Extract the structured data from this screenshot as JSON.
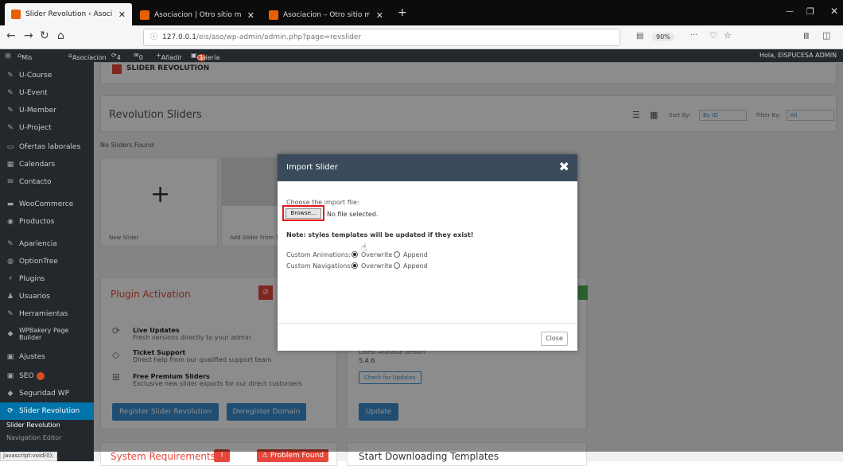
{
  "browser": {
    "tabs": [
      {
        "title": "Slider Revolution ‹ Asociacion",
        "close": "✕"
      },
      {
        "title": "Asociacion | Otro sitio más de",
        "close": "✕"
      },
      {
        "title": "Asociacion – Otro sitio más de",
        "close": "✕"
      }
    ],
    "new_tab": "+",
    "url_host": "127.0.0.1",
    "url_path": "/eis/aso/wp-admin/admin.php?page=revslider",
    "zoom": "90%",
    "more": "···"
  },
  "adminbar": {
    "my_sites": "Mis sitios",
    "site": "Asociacion",
    "updates": "4",
    "comments": "0",
    "add_new": "Añadir",
    "gallery_badge": "1",
    "gallery": "Galería",
    "greeting": "Hola, EISPUCESA ADMIN"
  },
  "sidebar": {
    "items": [
      {
        "label": "U-Course",
        "icon": "pin-icon"
      },
      {
        "label": "U-Event",
        "icon": "pin-icon"
      },
      {
        "label": "U-Member",
        "icon": "pin-icon"
      },
      {
        "label": "U-Project",
        "icon": "pin-icon"
      },
      {
        "label": "Ofertas laborales",
        "icon": "briefcase-icon"
      },
      {
        "label": "Calendars",
        "icon": "calendar-icon"
      },
      {
        "label": "Contacto",
        "icon": "mail-icon"
      },
      {
        "label": "WooCommerce",
        "icon": "woo-icon"
      },
      {
        "label": "Productos",
        "icon": "box-icon"
      },
      {
        "label": "Apariencia",
        "icon": "brush-icon"
      },
      {
        "label": "OptionTree",
        "icon": "tree-icon"
      },
      {
        "label": "Plugins",
        "icon": "plug-icon"
      },
      {
        "label": "Usuarios",
        "icon": "users-icon"
      },
      {
        "label": "Herramientas",
        "icon": "wrench-icon"
      },
      {
        "label": "WPBakery Page Builder",
        "icon": "bakery-icon"
      },
      {
        "label": "Ajustes",
        "icon": "settings-icon"
      },
      {
        "label": "SEO",
        "icon": "seo-icon"
      },
      {
        "label": "Seguridad WP",
        "icon": "shield-icon"
      },
      {
        "label": "Slider Revolution",
        "icon": "refresh-icon"
      }
    ],
    "sub": [
      "Slider Revolution",
      "Navigation Editor"
    ]
  },
  "content": {
    "logo": "SLIDER REVOLUTION",
    "header_title": "Revolution Sliders",
    "sort_label": "Sort By:",
    "sort_value": "By ID",
    "filter_label": "Filter By:",
    "filter_value": "All",
    "no_sliders": "No Sliders Found",
    "plus": "+",
    "new_slider": "New Slider",
    "add_template": "Add Slider From Template",
    "plugin_activation": "Plugin Activation",
    "features": [
      {
        "title": "Live Updates",
        "desc": "Fresh versions directly to your admin"
      },
      {
        "title": "Ticket Support",
        "desc": "Direct help from our qualified support team"
      },
      {
        "title": "Free Premium Sliders",
        "desc": "Exclusive new slider exports for our direct customers"
      }
    ],
    "register_btn": "Register Slider Revolution",
    "deregister_btn": "Deregister Domain",
    "latest_label": "Latest Available Version",
    "latest_value": "5.4.6",
    "check_updates": "Check for Updates",
    "update_btn": "Update",
    "sys_req": "System Requirements",
    "problem_found": "Problem Found",
    "start_download": "Start Downloading Templates"
  },
  "modal": {
    "title": "Import Slider",
    "close_x": "✖",
    "choose_label": "Choose the import file:",
    "browse": "Browse...",
    "no_file": "No file selected.",
    "note": "Note: styles templates will be updated if they exist!",
    "custom_animations": "Custom Animations:",
    "custom_navigations": "Custom Navigations:",
    "overwrite": "Overwrite",
    "append": "Append",
    "close_btn": "Close"
  },
  "statusbar": "javascript:void(0);",
  "colors": {
    "wp_dark": "#23282d",
    "wp_blue": "#0073aa",
    "modal_head": "#3b4a5a",
    "highlight": "#e01b1b"
  }
}
